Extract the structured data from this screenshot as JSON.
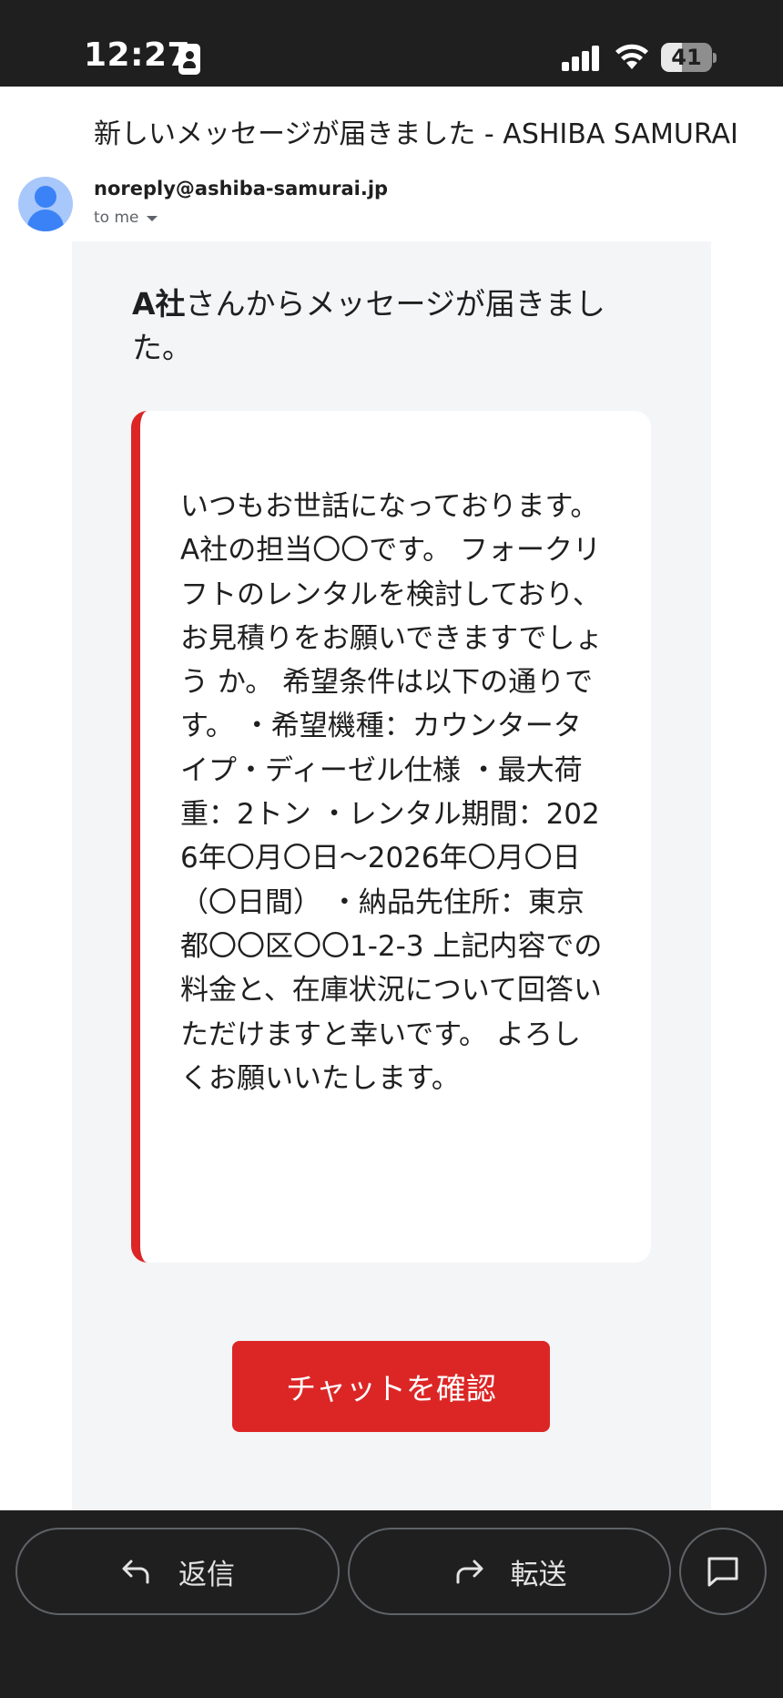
{
  "status_bar": {
    "time": "12:27",
    "battery": "41",
    "battery_level": 0.41
  },
  "email": {
    "subject": "新しいメッセージが届きました - ASHIBA SAMURAI",
    "sender": "noreply@ashiba-samurai.jp",
    "recipient": "to me"
  },
  "body": {
    "intro_company": "A社",
    "intro_rest": "さんからメッセージが届きました。",
    "message": "いつもお世話になっております。A社の担当〇〇です。 フォークリフトのレンタルを検討しており、お見積りをお願いできますでしょう か。 希望条件は以下の通りです。 ・希望機種：カウンタータイプ・ディーゼル仕様 ・最大荷重：2トン ・レンタル期間：2026年〇月〇日〜2026年〇月〇日（〇日間） ・納品先住所：東京都〇〇区〇〇1-2-3 上記内容での料金と、在庫状況について回答いただけますと幸いです。 よろしくお願いいたします。",
    "button_label": "チャットを確認"
  },
  "actions": {
    "reply": "返信",
    "forward": "転送"
  },
  "colors": {
    "accent": "#dc2626",
    "bar": "#1f1f1f"
  }
}
